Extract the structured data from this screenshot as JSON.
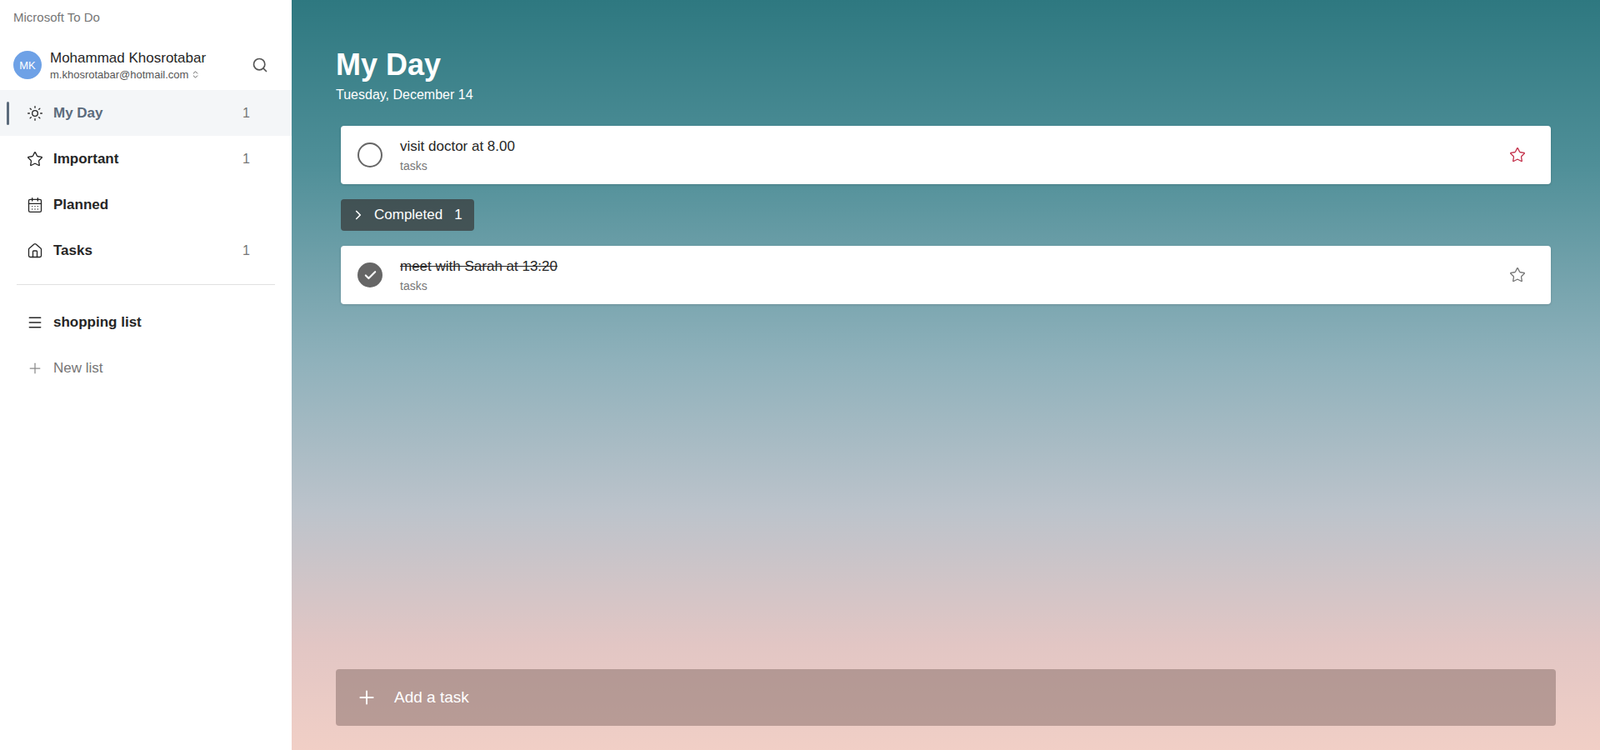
{
  "app": {
    "title": "Microsoft To Do"
  },
  "account": {
    "initials": "MK",
    "name": "Mohammad Khosrotabar",
    "email": "m.khosrotabar@hotmail.com"
  },
  "sidebar": {
    "items": [
      {
        "label": "My Day",
        "count": "1",
        "selected": true
      },
      {
        "label": "Important",
        "count": "1",
        "selected": false
      },
      {
        "label": "Planned",
        "count": "",
        "selected": false
      },
      {
        "label": "Tasks",
        "count": "1",
        "selected": false
      }
    ],
    "lists": [
      {
        "label": "shopping list",
        "selected": false
      }
    ],
    "new_list": "New list"
  },
  "page": {
    "title": "My Day",
    "date": "Tuesday, December 14"
  },
  "tasks": [
    {
      "title": "visit doctor at 8.00",
      "list": "tasks",
      "completed": false,
      "important": true
    }
  ],
  "completed_section": {
    "label": "Completed",
    "count": "1",
    "expanded": false
  },
  "completed_tasks": [
    {
      "title": "meet with Sarah at 13:20",
      "list": "tasks",
      "completed": true,
      "important": false
    }
  ],
  "add_task": {
    "placeholder": "Add a task"
  }
}
